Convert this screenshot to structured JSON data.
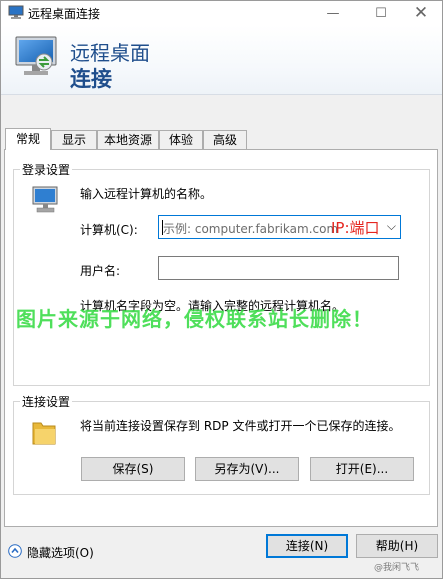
{
  "window": {
    "title": "远程桌面连接",
    "minimize_glyph": "—",
    "maximize_glyph": "☐",
    "close_glyph": "✕"
  },
  "banner": {
    "line1": "远程桌面",
    "line2": "连接"
  },
  "tabs": [
    {
      "label": "常规",
      "active": true
    },
    {
      "label": "显示",
      "active": false
    },
    {
      "label": "本地资源",
      "active": false
    },
    {
      "label": "体验",
      "active": false
    },
    {
      "label": "高级",
      "active": false
    }
  ],
  "login": {
    "group_label": "登录设置",
    "instruction": "输入远程计算机的名称。",
    "computer_label": "计算机(C):",
    "computer_placeholder": "示例: computer.fabrikam.com",
    "annotation": "IP:端口",
    "username_label": "用户名:",
    "username_value": "",
    "empty_hint": "计算机名字段为空。请输入完整的远程计算机名。"
  },
  "connection": {
    "group_label": "连接设置",
    "description": "将当前连接设置保存到 RDP 文件或打开一个已保存的连接。",
    "save_label": "保存(S)",
    "save_as_label": "另存为(V)...",
    "open_label": "打开(E)..."
  },
  "footer": {
    "hide_options_label": "隐藏选项(O)",
    "connect_label": "连接(N)",
    "help_label": "帮助(H)",
    "credit": "@我闲飞飞"
  },
  "watermark": "图片来源于网络，侵权联系站长删除！",
  "colors": {
    "accent": "#0078d7",
    "banner_text": "#1f4e8c",
    "annotation": "#e5261f",
    "watermark": "#3ddc4a"
  }
}
